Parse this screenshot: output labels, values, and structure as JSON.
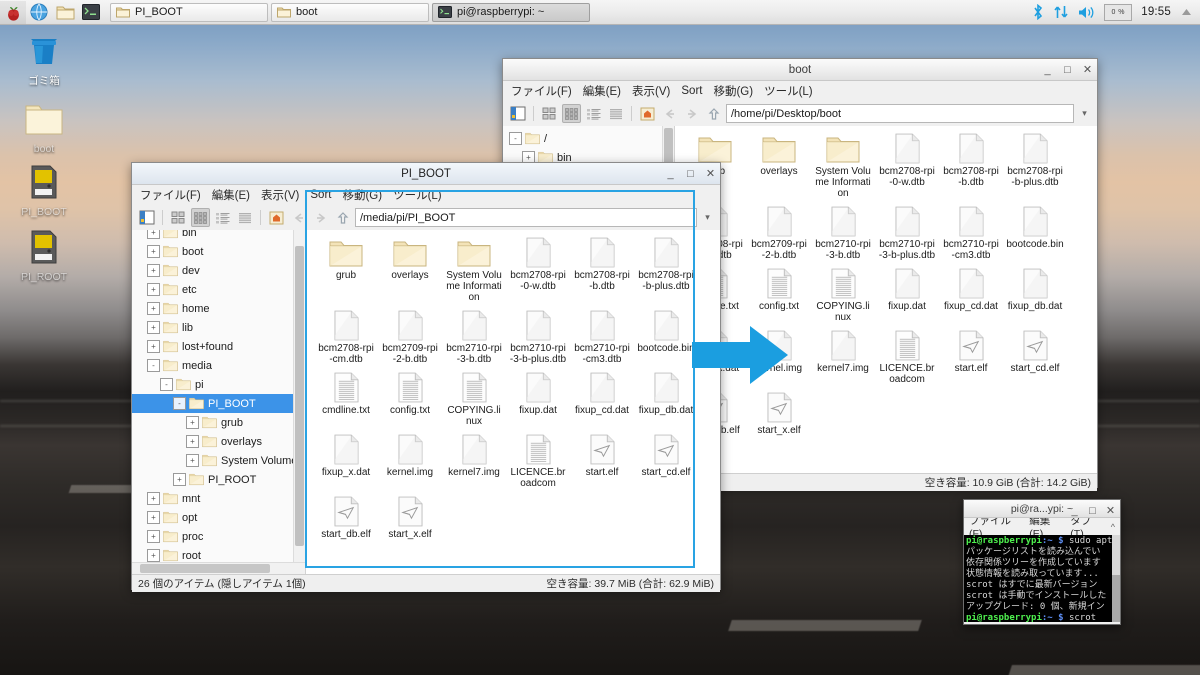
{
  "panel": {
    "launchers": [
      "raspberry-menu",
      "web-browser",
      "file-manager",
      "terminal"
    ],
    "tasks": [
      {
        "label": "PI_BOOT",
        "icon": "folder-icon",
        "active": false
      },
      {
        "label": "boot",
        "icon": "folder-icon",
        "active": false
      },
      {
        "label": "pi@raspberrypi: ~",
        "icon": "terminal-icon",
        "active": true
      }
    ],
    "tray": {
      "bluetooth": "bluetooth-icon",
      "network": "network-updown-icon",
      "volume": "volume-icon",
      "cpu_label": "0 %",
      "clock": "19:55",
      "eject": "eject-icon"
    }
  },
  "desktop_icons": [
    {
      "label": "ゴミ箱",
      "icon": "trash-icon"
    },
    {
      "label": "boot",
      "icon": "folder-icon"
    },
    {
      "label": "PI_BOOT",
      "icon": "sdcard-icon"
    },
    {
      "label": "PI_ROOT",
      "icon": "sdcard-icon"
    }
  ],
  "boot_window": {
    "title": "boot",
    "menu": [
      "ファイル(F)",
      "編集(E)",
      "表示(V)",
      "Sort",
      "移動(G)",
      "ツール(L)"
    ],
    "path": "/home/pi/Desktop/boot",
    "window_buttons": [
      "minimize",
      "maximize",
      "close"
    ],
    "tree": [
      {
        "label": "/",
        "depth": 0,
        "state": "-"
      },
      {
        "label": "bin",
        "depth": 1,
        "state": "+"
      }
    ],
    "files": [
      {
        "name": "grub",
        "type": "folder"
      },
      {
        "name": "overlays",
        "type": "folder"
      },
      {
        "name": "System Volume Information",
        "type": "folder"
      },
      {
        "name": "bcm2708-rpi-0-w.dtb",
        "type": "file"
      },
      {
        "name": "bcm2708-rpi-b.dtb",
        "type": "file"
      },
      {
        "name": "bcm2708-rpi-b-plus.dtb",
        "type": "file"
      },
      {
        "name": "bcm2708-rpi-cm.dtb",
        "type": "file"
      },
      {
        "name": "bcm2709-rpi-2-b.dtb",
        "type": "file"
      },
      {
        "name": "bcm2710-rpi-3-b.dtb",
        "type": "file"
      },
      {
        "name": "bcm2710-rpi-3-b-plus.dtb",
        "type": "file"
      },
      {
        "name": "bcm2710-rpi-cm3.dtb",
        "type": "file"
      },
      {
        "name": "bootcode.bin",
        "type": "file"
      },
      {
        "name": "cmdline.txt",
        "type": "text"
      },
      {
        "name": "config.txt",
        "type": "text"
      },
      {
        "name": "COPYING.linux",
        "type": "text"
      },
      {
        "name": "fixup.dat",
        "type": "file"
      },
      {
        "name": "fixup_cd.dat",
        "type": "file"
      },
      {
        "name": "fixup_db.dat",
        "type": "file"
      },
      {
        "name": "fixup_x.dat",
        "type": "file"
      },
      {
        "name": "kernel.img",
        "type": "file"
      },
      {
        "name": "kernel7.img",
        "type": "file"
      },
      {
        "name": "LICENCE.broadcom",
        "type": "text"
      },
      {
        "name": "start.elf",
        "type": "elf"
      },
      {
        "name": "start_cd.elf",
        "type": "elf"
      },
      {
        "name": "start_db.elf",
        "type": "elf"
      },
      {
        "name": "start_x.elf",
        "type": "elf"
      }
    ],
    "status_right": "空き容量: 10.9 GiB (合計: 14.2 GiB)"
  },
  "piboot_window": {
    "title": "PI_BOOT",
    "menu": [
      "ファイル(F)",
      "編集(E)",
      "表示(V)",
      "Sort",
      "移動(G)",
      "ツール(L)"
    ],
    "path": "/media/pi/PI_BOOT",
    "window_buttons": [
      "minimize",
      "maximize",
      "close"
    ],
    "tree": [
      {
        "label": "bin",
        "depth": 1,
        "state": "+",
        "clipped": true
      },
      {
        "label": "boot",
        "depth": 1,
        "state": "+"
      },
      {
        "label": "dev",
        "depth": 1,
        "state": "+"
      },
      {
        "label": "etc",
        "depth": 1,
        "state": "+"
      },
      {
        "label": "home",
        "depth": 1,
        "state": "+"
      },
      {
        "label": "lib",
        "depth": 1,
        "state": "+"
      },
      {
        "label": "lost+found",
        "depth": 1,
        "state": "+"
      },
      {
        "label": "media",
        "depth": 1,
        "state": "-"
      },
      {
        "label": "pi",
        "depth": 2,
        "state": "-"
      },
      {
        "label": "PI_BOOT",
        "depth": 3,
        "state": "-",
        "selected": true
      },
      {
        "label": "grub",
        "depth": 4,
        "state": "+"
      },
      {
        "label": "overlays",
        "depth": 4,
        "state": "+"
      },
      {
        "label": "System Volume Informa",
        "depth": 4,
        "state": "+"
      },
      {
        "label": "PI_ROOT",
        "depth": 3,
        "state": "+"
      },
      {
        "label": "mnt",
        "depth": 1,
        "state": "+"
      },
      {
        "label": "opt",
        "depth": 1,
        "state": "+"
      },
      {
        "label": "proc",
        "depth": 1,
        "state": "+"
      },
      {
        "label": "root",
        "depth": 1,
        "state": "+"
      }
    ],
    "files": [
      {
        "name": "grub",
        "type": "folder"
      },
      {
        "name": "overlays",
        "type": "folder"
      },
      {
        "name": "System Volume Information",
        "type": "folder"
      },
      {
        "name": "bcm2708-rpi-0-w.dtb",
        "type": "file"
      },
      {
        "name": "bcm2708-rpi-b.dtb",
        "type": "file"
      },
      {
        "name": "bcm2708-rpi-b-plus.dtb",
        "type": "file"
      },
      {
        "name": "bcm2708-rpi-cm.dtb",
        "type": "file"
      },
      {
        "name": "bcm2709-rpi-2-b.dtb",
        "type": "file"
      },
      {
        "name": "bcm2710-rpi-3-b.dtb",
        "type": "file"
      },
      {
        "name": "bcm2710-rpi-3-b-plus.dtb",
        "type": "file"
      },
      {
        "name": "bcm2710-rpi-cm3.dtb",
        "type": "file"
      },
      {
        "name": "bootcode.bin",
        "type": "file"
      },
      {
        "name": "cmdline.txt",
        "type": "text"
      },
      {
        "name": "config.txt",
        "type": "text"
      },
      {
        "name": "COPYING.linux",
        "type": "text"
      },
      {
        "name": "fixup.dat",
        "type": "file"
      },
      {
        "name": "fixup_cd.dat",
        "type": "file"
      },
      {
        "name": "fixup_db.dat",
        "type": "file"
      },
      {
        "name": "fixup_x.dat",
        "type": "file"
      },
      {
        "name": "kernel.img",
        "type": "file"
      },
      {
        "name": "kernel7.img",
        "type": "file"
      },
      {
        "name": "LICENCE.broadcom",
        "type": "text"
      },
      {
        "name": "start.elf",
        "type": "elf"
      },
      {
        "name": "start_cd.elf",
        "type": "elf"
      },
      {
        "name": "start_db.elf",
        "type": "elf"
      },
      {
        "name": "start_x.elf",
        "type": "elf"
      }
    ],
    "status_left": "26 個のアイテム (隠しアイテム 1個)",
    "status_right": "空き容量: 39.7 MiB (合計: 62.9 MiB)"
  },
  "terminal": {
    "title": "pi@ra...ypi: ~",
    "menu": [
      "ファイル(F)",
      "編集(E)",
      "タブ(T)"
    ],
    "lines": [
      {
        "prompt": "pi@raspberrypi",
        "path": ":~ $",
        "cmd": " sudo apt-g"
      },
      {
        "text": "パッケージリストを読み込んでい"
      },
      {
        "text": "依存関係ツリーを作成しています"
      },
      {
        "text": "状態情報を読み取っています..."
      },
      {
        "text": "scrot はすでに最新バージョン"
      },
      {
        "text": "scrot は手動でインストールした"
      },
      {
        "text": "アップグレード: 0 個、新規イン"
      },
      {
        "prompt": "pi@raspberrypi",
        "path": ":~ $",
        "cmd": " scrot"
      },
      {
        "prompt": "pi@raspberrypi",
        "path": ":~ $",
        "cmd": " scrot",
        "cursor": true
      }
    ]
  },
  "annotation": {
    "highlight_color": "#29a3e3",
    "arrow_color": "#1b9ee0",
    "arrow_label": "right-arrow"
  }
}
